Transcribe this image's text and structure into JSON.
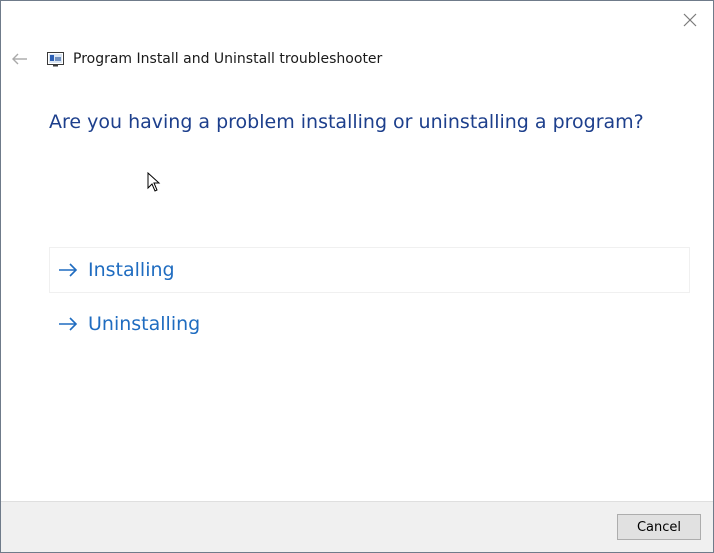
{
  "window": {
    "close_icon": "close-icon"
  },
  "header": {
    "back_icon": "back-arrow-icon",
    "app_icon": "troubleshooter-app-icon",
    "title": "Program Install and Uninstall troubleshooter"
  },
  "main": {
    "question": "Are you having a problem installing or uninstalling a program?",
    "options": [
      {
        "label": "Installing",
        "icon": "arrow-right-icon"
      },
      {
        "label": "Uninstalling",
        "icon": "arrow-right-icon"
      }
    ]
  },
  "footer": {
    "cancel_label": "Cancel"
  },
  "colors": {
    "heading": "#1d3f8c",
    "link": "#1f6cc0",
    "footer_bg": "#f0f0f0"
  }
}
